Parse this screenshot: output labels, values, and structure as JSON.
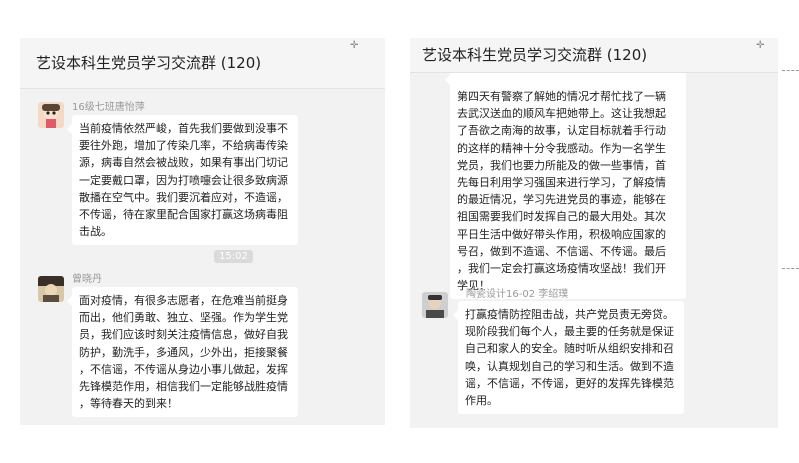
{
  "left_window": {
    "title": "艺设本科生党员学习交流群 (120)",
    "messages": [
      {
        "sender": "16级七班唐怡萍",
        "lines": [
          "当前疫情依然严峻，首先我们要做到没事不",
          "要往外跑，增加了传染几率，不给病毒传染",
          "源，病毒自然会被战败，如果有事出门切记",
          "一定要戴口罩，因为打喷嚏会让很多致病源",
          "散播在空气中。我们要沉着应对，不造谣，",
          "不传谣，待在家里配合国家打赢这场病毒阻",
          "击战。"
        ]
      },
      {
        "sender": "曾晓丹",
        "lines": [
          "面对疫情，有很多志愿者，在危难当前挺身",
          "而出，他们勇敢、独立、坚强。作为学生党",
          "员，我们应该时刻关注疫情信息，做好自我",
          "防护，勤洗手，多通风，少外出，拒接聚餐",
          "，不信谣，不传谣从身边小事儿做起，发挥",
          "先锋模范作用，相信我们一定能够战胜疫情",
          "，等待春天的到来！"
        ]
      }
    ],
    "time_divider": "15:02"
  },
  "right_window": {
    "title": "艺设本科生党员学习交流群 (120)",
    "messages": [
      {
        "sender": "",
        "lines": [
          "第四天有警察了解她的情况才帮忙找了一辆",
          "去武汉送血的顺风车把她带上。这让我想起",
          "了吾欲之南海的故事，认定目标就着手行动",
          "的这样的精神十分令我感动。作为一名学生",
          "党员，我们也要力所能及的做一些事情，首",
          "先每日利用学习强国来进行学习，了解疫情",
          "的最近情况，学习先进党员的事迹，能够在",
          "祖国需要我们时发挥自己的最大用处。其次",
          "平日生活中做好带头作用，积极响应国家的",
          "号召，做到不造谣、不信谣、不传谣。最后",
          "，我们一定会打赢这场疫情攻坚战！我们开",
          "学见！"
        ]
      },
      {
        "sender": "陶瓷设计16-02 李绍璞",
        "lines": [
          "打赢疫情防控阻击战，共产党员责无旁贷。",
          "现阶段我们每个人，最主要的任务就是保证",
          "自己和家人的安全。随时听从组织安排和召",
          "唤，认真规划自己的学习和生活。做到不造",
          "谣，不信谣，不传谣，更好的发挥先锋模范",
          "作用。"
        ]
      }
    ]
  },
  "colors": {
    "panel_bg": "#f2f2f2",
    "bubble_bg": "#ffffff",
    "sender_text": "#9a9a9a",
    "time_chip": "#dadada"
  }
}
